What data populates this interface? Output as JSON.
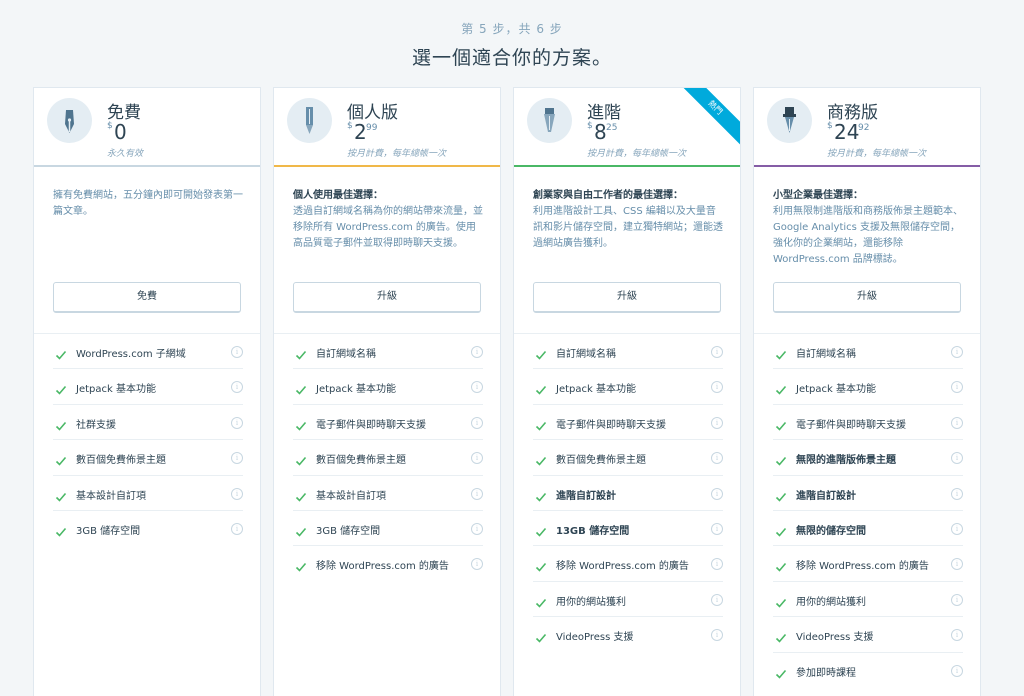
{
  "header": {
    "step": "第 5 步，共 6 步",
    "title": "選一個適合你的方案。"
  },
  "plans": [
    {
      "name": "免費",
      "currency": "$",
      "price_int": "0",
      "price_dec": "",
      "term": "永久有效",
      "ribbon": "",
      "desc_title": "",
      "desc_body": "擁有免費網站，五分鐘內即可開始發表第一篇文章。",
      "button": "免費",
      "features": [
        {
          "label": "WordPress.com 子網域",
          "bold": false
        },
        {
          "label": "Jetpack 基本功能",
          "bold": false
        },
        {
          "label": "社群支援",
          "bold": false
        },
        {
          "label": "數百個免費佈景主題",
          "bold": false
        },
        {
          "label": "基本設計自訂項",
          "bold": false
        },
        {
          "label": "3GB 儲存空間",
          "bold": false
        }
      ]
    },
    {
      "name": "個人版",
      "currency": "$",
      "price_int": "2",
      "price_dec": "99",
      "term": "按月計費，每年總帳一次",
      "ribbon": "",
      "desc_title": "個人使用最佳選擇：",
      "desc_body": "透過自訂網域名稱為你的網站帶來流量，並移除所有 WordPress.com 的廣告。使用高品質電子郵件並取得即時聊天支援。",
      "button": "升級",
      "features": [
        {
          "label": "自訂網域名稱",
          "bold": false
        },
        {
          "label": "Jetpack 基本功能",
          "bold": false
        },
        {
          "label": "電子郵件與即時聊天支援",
          "bold": false
        },
        {
          "label": "數百個免費佈景主題",
          "bold": false
        },
        {
          "label": "基本設計自訂項",
          "bold": false
        },
        {
          "label": "3GB 儲存空間",
          "bold": false
        },
        {
          "label": "移除 WordPress.com 的廣告",
          "bold": false
        }
      ]
    },
    {
      "name": "進階",
      "currency": "$",
      "price_int": "8",
      "price_dec": "25",
      "term": "按月計費，每年總帳一次",
      "ribbon": "熱門",
      "desc_title": "創業家與自由工作者的最佳選擇：",
      "desc_body": "利用進階設計工具、CSS 編輯以及大量音訊和影片儲存空間，建立獨特網站；還能透過網站廣告獲利。",
      "button": "升級",
      "features": [
        {
          "label": "自訂網域名稱",
          "bold": false
        },
        {
          "label": "Jetpack 基本功能",
          "bold": false
        },
        {
          "label": "電子郵件與即時聊天支援",
          "bold": false
        },
        {
          "label": "數百個免費佈景主題",
          "bold": false
        },
        {
          "label": "進階自訂設計",
          "bold": true
        },
        {
          "label": "13GB 儲存空間",
          "bold": true
        },
        {
          "label": "移除 WordPress.com 的廣告",
          "bold": false
        },
        {
          "label": "用你的網站獲利",
          "bold": false
        },
        {
          "label": "VideoPress 支援",
          "bold": false
        }
      ]
    },
    {
      "name": "商務版",
      "currency": "$",
      "price_int": "24",
      "price_dec": "92",
      "term": "按月計費，每年總帳一次",
      "ribbon": "",
      "desc_title": "小型企業最佳選擇：",
      "desc_body": "利用無限制進階版和商務版佈景主題範本、Google Analytics 支援及無限儲存空間，強化你的企業網站，還能移除 WordPress.com 品牌標誌。",
      "button": "升級",
      "features": [
        {
          "label": "自訂網域名稱",
          "bold": false
        },
        {
          "label": "Jetpack 基本功能",
          "bold": false
        },
        {
          "label": "電子郵件與即時聊天支援",
          "bold": false
        },
        {
          "label": "無限的進階版佈景主題",
          "bold": true
        },
        {
          "label": "進階自訂設計",
          "bold": true
        },
        {
          "label": "無限的儲存空間",
          "bold": true
        },
        {
          "label": "移除 WordPress.com 的廣告",
          "bold": false
        },
        {
          "label": "用你的網站獲利",
          "bold": false
        },
        {
          "label": "VideoPress 支援",
          "bold": false
        },
        {
          "label": "參加即時課程",
          "bold": false
        }
      ]
    }
  ],
  "colors": {
    "free": "#c8d7e1",
    "personal": "#f0b849",
    "premium": "#4ab866",
    "business": "#855da6",
    "check": "#4ab866",
    "ribbon": "#00aadc"
  },
  "icons": [
    "pen-nib-icon",
    "pen-icon",
    "brush-icon",
    "ink-pen-icon"
  ]
}
